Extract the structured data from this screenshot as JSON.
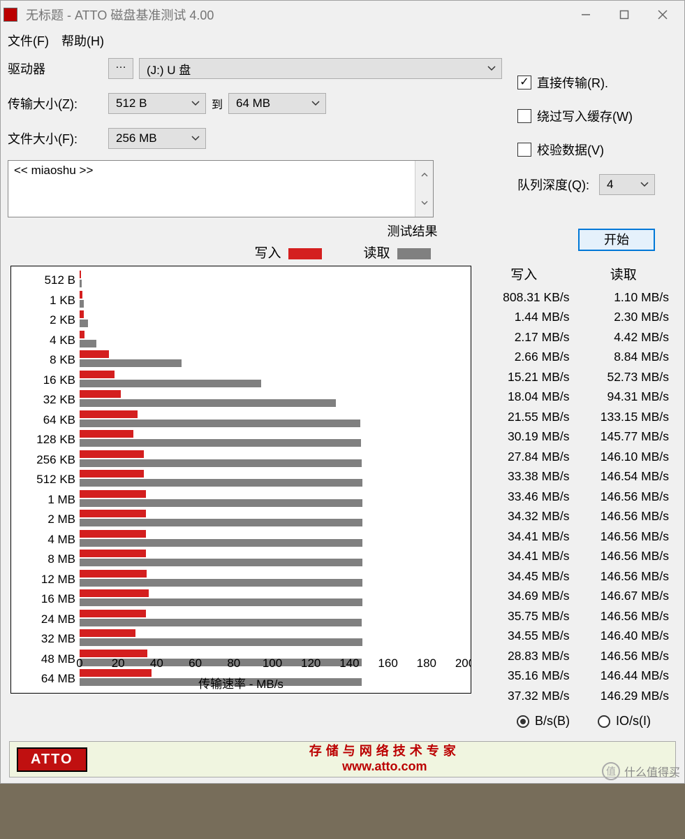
{
  "window": {
    "title": "无标题 - ATTO 磁盘基准测试 4.00"
  },
  "menu": {
    "file": "文件(F)",
    "help": "帮助(H)"
  },
  "form": {
    "drive_label": "驱动器",
    "drive_value": "(J:) U 盘",
    "transfer_size_label": "传输大小(Z):",
    "transfer_from": "512 B",
    "transfer_to_label": "到",
    "transfer_to": "64 MB",
    "file_size_label": "文件大小(F):",
    "file_size": "256 MB"
  },
  "options": {
    "direct_transfer": "直接传输(R).",
    "bypass_cache": "绕过写入缓存(W)",
    "verify": "校验数据(V)",
    "queue_depth_label": "队列深度(Q):",
    "queue_depth": "4",
    "start": "开始"
  },
  "desc_text": "<< miaoshu >>",
  "results": {
    "title": "测试结果",
    "write": "写入",
    "read": "读取",
    "xaxis": "传输速率 - MB/s",
    "col_write": "写入",
    "col_read": "读取"
  },
  "units": {
    "bs": "B/s(B)",
    "ios": "IO/s(I)"
  },
  "footer": {
    "brand": "ATTO",
    "tagline": "存储与网络技术专家",
    "url": "www.atto.com"
  },
  "watermark": "什么值得买",
  "chart_data": {
    "type": "bar",
    "categories": [
      "512 B",
      "1 KB",
      "2 KB",
      "4 KB",
      "8 KB",
      "16 KB",
      "32 KB",
      "64 KB",
      "128 KB",
      "256 KB",
      "512 KB",
      "1 MB",
      "2 MB",
      "4 MB",
      "8 MB",
      "12 MB",
      "16 MB",
      "24 MB",
      "32 MB",
      "48 MB",
      "64 MB"
    ],
    "series": [
      {
        "name": "写入",
        "values": [
          0.79,
          1.44,
          2.17,
          2.66,
          15.21,
          18.04,
          21.55,
          30.19,
          27.84,
          33.38,
          33.46,
          34.32,
          34.41,
          34.41,
          34.45,
          34.69,
          35.75,
          34.55,
          28.83,
          35.16,
          37.32
        ],
        "display": [
          "808.31 KB/s",
          "1.44 MB/s",
          "2.17 MB/s",
          "2.66 MB/s",
          "15.21 MB/s",
          "18.04 MB/s",
          "21.55 MB/s",
          "30.19 MB/s",
          "27.84 MB/s",
          "33.38 MB/s",
          "33.46 MB/s",
          "34.32 MB/s",
          "34.41 MB/s",
          "34.41 MB/s",
          "34.45 MB/s",
          "34.69 MB/s",
          "35.75 MB/s",
          "34.55 MB/s",
          "28.83 MB/s",
          "35.16 MB/s",
          "37.32 MB/s"
        ]
      },
      {
        "name": "读取",
        "values": [
          1.1,
          2.3,
          4.42,
          8.84,
          52.73,
          94.31,
          133.15,
          145.77,
          146.1,
          146.54,
          146.56,
          146.56,
          146.56,
          146.56,
          146.56,
          146.67,
          146.56,
          146.4,
          146.56,
          146.44,
          146.29
        ],
        "display": [
          "1.10 MB/s",
          "2.30 MB/s",
          "4.42 MB/s",
          "8.84 MB/s",
          "52.73 MB/s",
          "94.31 MB/s",
          "133.15 MB/s",
          "145.77 MB/s",
          "146.10 MB/s",
          "146.54 MB/s",
          "146.56 MB/s",
          "146.56 MB/s",
          "146.56 MB/s",
          "146.56 MB/s",
          "146.56 MB/s",
          "146.67 MB/s",
          "146.56 MB/s",
          "146.40 MB/s",
          "146.56 MB/s",
          "146.44 MB/s",
          "146.29 MB/s"
        ]
      }
    ],
    "x_ticks": [
      0,
      20,
      40,
      60,
      80,
      100,
      120,
      140,
      160,
      180,
      200
    ],
    "xlim": [
      0,
      200
    ],
    "xlabel": "传输速率 - MB/s"
  }
}
